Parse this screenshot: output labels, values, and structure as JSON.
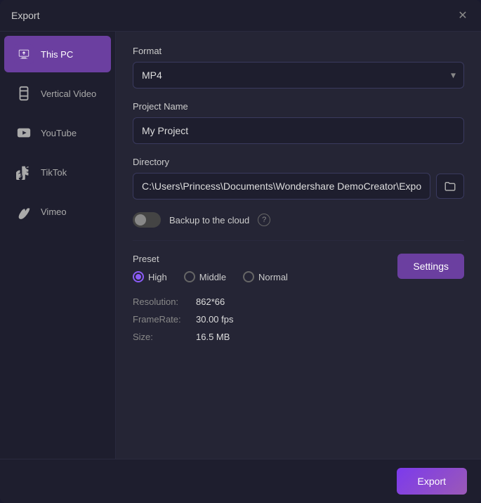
{
  "window": {
    "title": "Export"
  },
  "sidebar": {
    "items": [
      {
        "id": "this-pc",
        "label": "This PC",
        "active": true
      },
      {
        "id": "vertical-video",
        "label": "Vertical Video",
        "active": false
      },
      {
        "id": "youtube",
        "label": "YouTube",
        "active": false
      },
      {
        "id": "tiktok",
        "label": "TikTok",
        "active": false
      },
      {
        "id": "vimeo",
        "label": "Vimeo",
        "active": false
      }
    ]
  },
  "main": {
    "format_label": "Format",
    "format_value": "MP4",
    "project_name_label": "Project Name",
    "project_name_value": "My Project",
    "directory_label": "Directory",
    "directory_value": "C:\\Users\\Princess\\Documents\\Wondershare DemoCreator\\ExportFiles",
    "cloud_label": "Backup to the cloud",
    "cloud_enabled": false,
    "preset_label": "Preset",
    "presets": [
      {
        "id": "high",
        "label": "High",
        "selected": true
      },
      {
        "id": "middle",
        "label": "Middle",
        "selected": false
      },
      {
        "id": "normal",
        "label": "Normal",
        "selected": false
      }
    ],
    "settings_btn": "Settings",
    "specs": [
      {
        "key": "Resolution:",
        "value": "862*66"
      },
      {
        "key": "FrameRate:",
        "value": "30.00 fps"
      },
      {
        "key": "Size:",
        "value": "16.5 MB"
      }
    ],
    "export_btn": "Export"
  },
  "icons": {
    "close": "✕",
    "chevron_down": "▾",
    "help": "?",
    "folder": "📁"
  }
}
